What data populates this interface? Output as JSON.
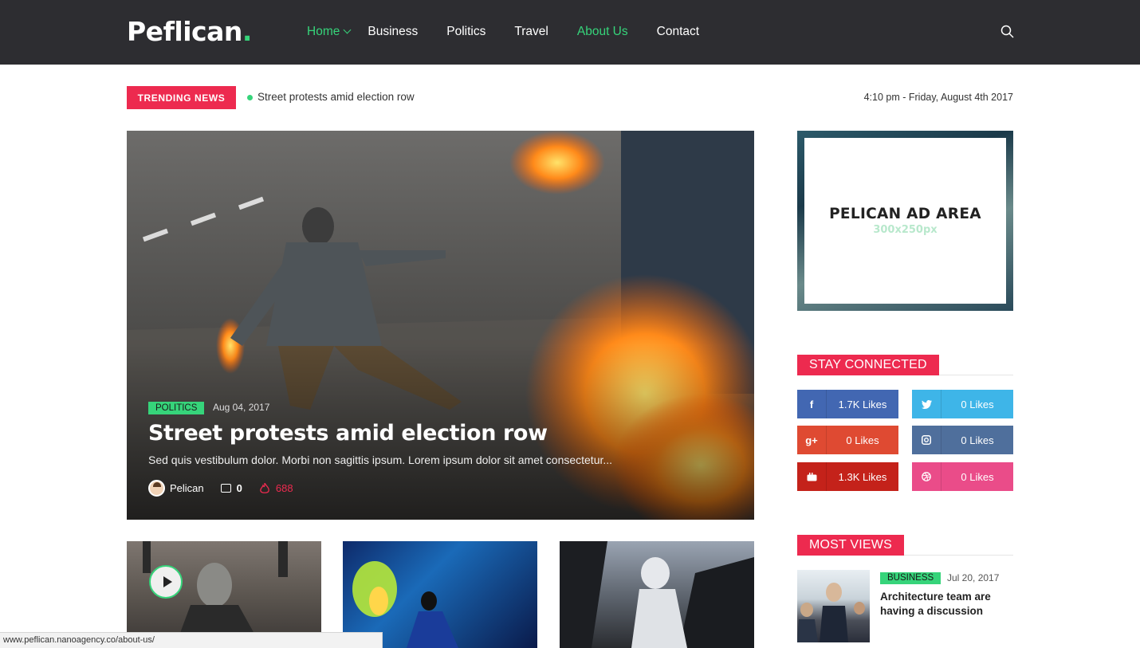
{
  "header": {
    "logo_text": "Peflican",
    "logo_dot": ".",
    "nav": [
      {
        "label": "Home",
        "active": true,
        "has_dropdown": true
      },
      {
        "label": "Business",
        "active": false
      },
      {
        "label": "Politics",
        "active": false
      },
      {
        "label": "Travel",
        "active": false
      },
      {
        "label": "About Us",
        "active": true
      },
      {
        "label": "Contact",
        "active": false
      }
    ],
    "search_icon": "search-icon"
  },
  "trending": {
    "badge": "TRENDING NEWS",
    "headline": "Street protests amid election row",
    "datetime": "4:10 pm - Friday, August 4th 2017"
  },
  "hero": {
    "category": "POLITICS",
    "date": "Aug 04, 2017",
    "title": "Street protests amid election row",
    "excerpt": "Sed quis vestibulum dolor. Morbi non sagittis ipsum. Lorem ipsum dolor sit amet consectetur...",
    "author": "Pelican",
    "comments": "0",
    "views": "688"
  },
  "thumbs": [
    {
      "has_play": true
    },
    {
      "has_play": false
    },
    {
      "has_play": false
    }
  ],
  "status_bar": {
    "url": "www.peflican.nanoagency.co/about-us/"
  },
  "sidebar": {
    "ad": {
      "title": "PELICAN AD AREA",
      "size": "300x250px"
    },
    "stay_connected": {
      "heading": "STAY CONNECTED",
      "items": [
        {
          "network": "facebook",
          "icon": "f",
          "count": "1.7K Likes",
          "color": "#4267b2"
        },
        {
          "network": "twitter",
          "icon": "t",
          "count": "0 Likes",
          "color": "#3eb5e8"
        },
        {
          "network": "google-plus",
          "icon": "g+",
          "count": "0 Likes",
          "color": "#df4a32"
        },
        {
          "network": "instagram",
          "icon": "ig",
          "count": "0 Likes",
          "color": "#4f6f9c"
        },
        {
          "network": "youtube",
          "icon": "yt",
          "count": "1.3K Likes",
          "color": "#c4221a"
        },
        {
          "network": "dribbble",
          "icon": "dr",
          "count": "0 Likes",
          "color": "#ea4c89"
        }
      ]
    },
    "most_views": {
      "heading": "MOST VIEWS",
      "item": {
        "category": "BUSINESS",
        "date": "Jul 20, 2017",
        "title": "Architecture team are having a discussion"
      }
    }
  },
  "colors": {
    "accent_green": "#36d47a",
    "accent_red": "#ed2a4f",
    "header_bg": "#2d2d31"
  }
}
